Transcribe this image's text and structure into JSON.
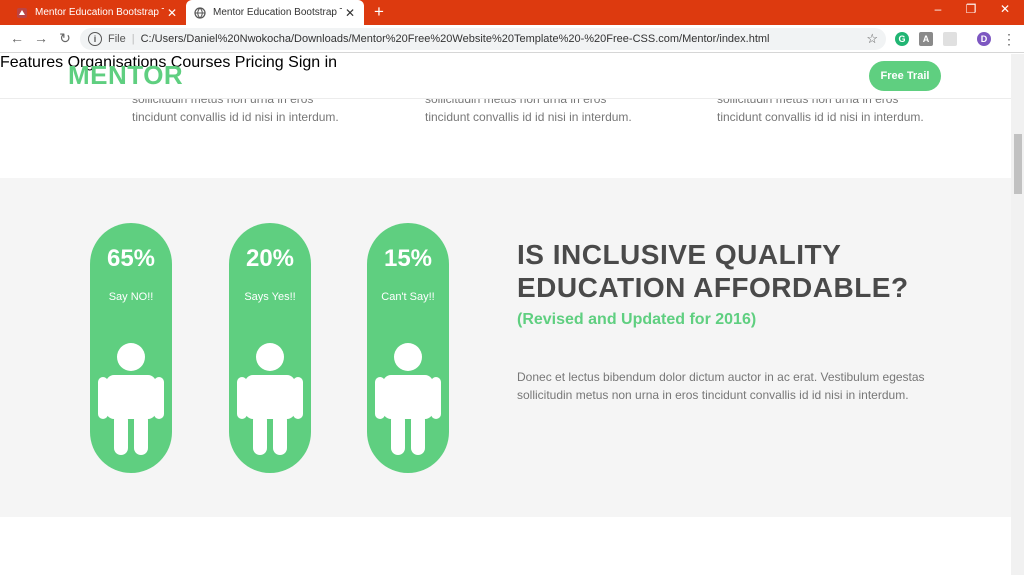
{
  "browser": {
    "tabs": [
      {
        "title": "Mentor Education Bootstrap The",
        "active": false
      },
      {
        "title": "Mentor Education Bootstrap The",
        "active": true
      }
    ],
    "new_tab": "+",
    "window_controls": {
      "minimize": "–",
      "restore": "❐",
      "close": "✕"
    },
    "address": {
      "info": "i",
      "file_label": "File",
      "separator": "|",
      "url": "C:/Users/Daniel%20Nwokocha/Downloads/Mentor%20Free%20Website%20Template%20-%20Free-CSS.com/Mentor/index.html"
    },
    "profile_initial": "D",
    "colors": {
      "tabbar": "#dd3a0f"
    }
  },
  "site": {
    "logo": {
      "part1": "ME",
      "part2": "NTOR"
    },
    "nav": [
      "Features",
      "Organisations",
      "Courses",
      "Pricing",
      "Sign in"
    ],
    "cta": "Free Trail",
    "prev_columns": [
      {
        "line1": "sollicitudin metus non urna in eros",
        "line2": "tincidunt convallis id id nisi in interdum."
      },
      {
        "line1": "sollicitudin metus non urna in eros",
        "line2": "tincidunt convallis id id nisi in interdum."
      },
      {
        "line1": "sollicitudin metus non urna in eros",
        "line2": "tincidunt convallis id id nisi in interdum."
      }
    ],
    "stats": [
      {
        "percent": "65%",
        "label": "Say NO!!"
      },
      {
        "percent": "20%",
        "label": "Says Yes!!"
      },
      {
        "percent": "15%",
        "label": "Can't Say!!"
      }
    ],
    "headline_line1": "IS INCLUSIVE QUALITY",
    "headline_line2": "EDUCATION AFFORDABLE?",
    "subheadline": "(Revised and Updated for 2016)",
    "body_line1": "Donec et lectus bibendum dolor dictum auctor in ac erat. Vestibulum egestas",
    "body_line2": "sollicitudin metus non urna in eros tincidunt convallis id id nisi in interdum.",
    "colors": {
      "accent": "#5fcf80",
      "band": "#f5f5f5",
      "heading": "#4a4a4a"
    }
  }
}
